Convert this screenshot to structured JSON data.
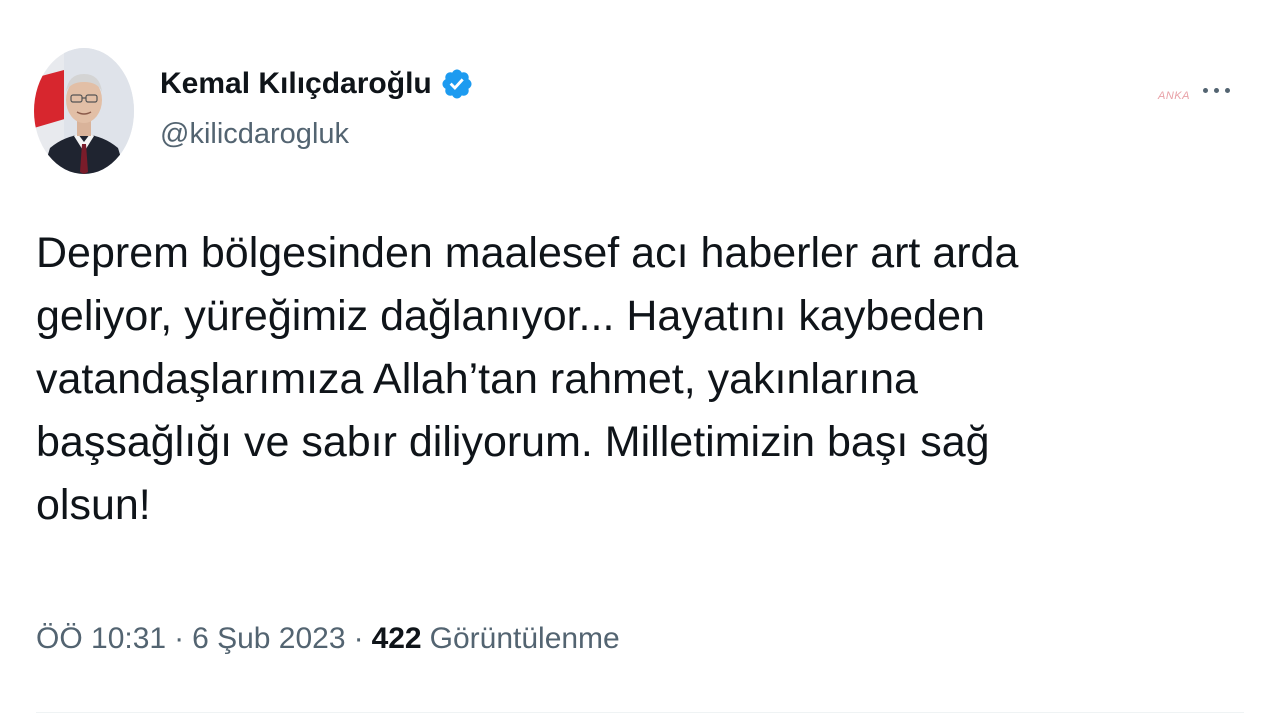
{
  "tweet": {
    "author": {
      "display_name": "Kemal Kılıçdaroğlu",
      "handle": "@kilicdarogluk",
      "verified": true
    },
    "watermark_text": "ANKA",
    "text": "Deprem bölgesinden maalesef acı haberler art arda\ngeliyor, yüreğimiz dağlanıyor... Hayatını kaybeden\nvatandaşlarımıza Allah’tan rahmet, yakınlarına\nbaşsağlığı ve sabır diliyorum. Milletimizin başı sağ\nolsun!",
    "meta": {
      "time": "ÖÖ 10:31",
      "separator": "·",
      "date": "6 Şub 2023",
      "views_count": "422",
      "views_label": "Görüntülenme"
    },
    "colors": {
      "text": "#0f1419",
      "secondary": "#536471",
      "verified_badge": "#1d9bf0"
    },
    "icons": {
      "verified": "verified-badge-icon",
      "more": "more-horizontal-icon"
    }
  }
}
